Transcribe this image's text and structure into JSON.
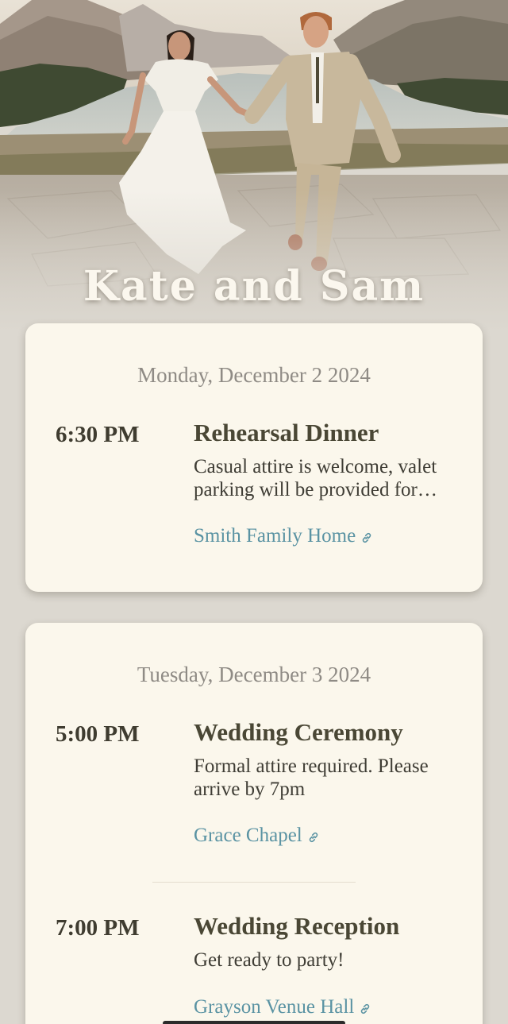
{
  "hero": {
    "title": "Kate and Sam",
    "image_icon": "couple-photo"
  },
  "days": [
    {
      "date": "Monday, December 2 2024",
      "events": [
        {
          "time": "6:30 PM",
          "name": "Rehearsal Dinner",
          "description": "Casual attire is welcome, valet parking will be provided for guests",
          "location": "Smith Family Home",
          "link_icon": "link-icon"
        }
      ]
    },
    {
      "date": "Tuesday, December 3 2024",
      "events": [
        {
          "time": "5:00 PM",
          "name": "Wedding Ceremony",
          "description": "Formal attire required. Please arrive by 7pm",
          "location": "Grace Chapel",
          "link_icon": "link-icon"
        },
        {
          "time": "7:00 PM",
          "name": "Wedding Reception",
          "description": "Get ready to party!",
          "location": "Grayson Venue Hall",
          "link_icon": "link-icon"
        }
      ]
    }
  ],
  "colors": {
    "background": "#dcd8d0",
    "card": "#fbf7ec",
    "link": "#5a93a3",
    "heading": "#4a4735",
    "date": "#8f8b85"
  }
}
